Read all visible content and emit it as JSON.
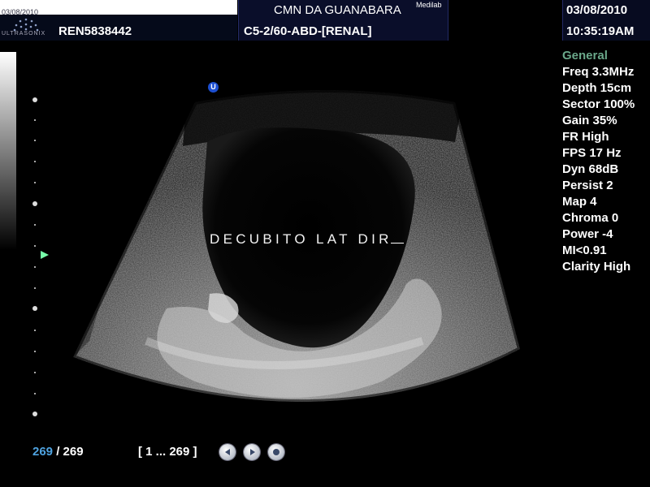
{
  "header": {
    "small_date": "03/08/2010",
    "logo_text": "ULTRASONIX",
    "patient_id": "REN5838442",
    "institution": "CMN DA GUANABARA",
    "brand": "Medilab",
    "preset": "C5-2/60-ABD-[RENAL]",
    "date": "03/08/2010",
    "time": "10:35:19AM"
  },
  "image": {
    "orientation_marker": "U",
    "annotation": "DECUBITO LAT DIR"
  },
  "params": {
    "title": "General",
    "lines": [
      "Freq 3.3MHz",
      "Depth 15cm",
      "Sector 100%",
      "Gain 35%",
      "FR High",
      "FPS 17 Hz",
      "Dyn 68dB",
      "Persist 2",
      "Map 4",
      "Chroma 0",
      "Power -4",
      "MI<0.91",
      "Clarity High"
    ]
  },
  "playback": {
    "current": "269",
    "separator": "/",
    "total": "269",
    "range": "[ 1 ... 269 ]"
  },
  "colors": {
    "accent_blue": "#4fa3e0",
    "param_title": "#6aa88a",
    "focus_marker": "#7fa"
  }
}
